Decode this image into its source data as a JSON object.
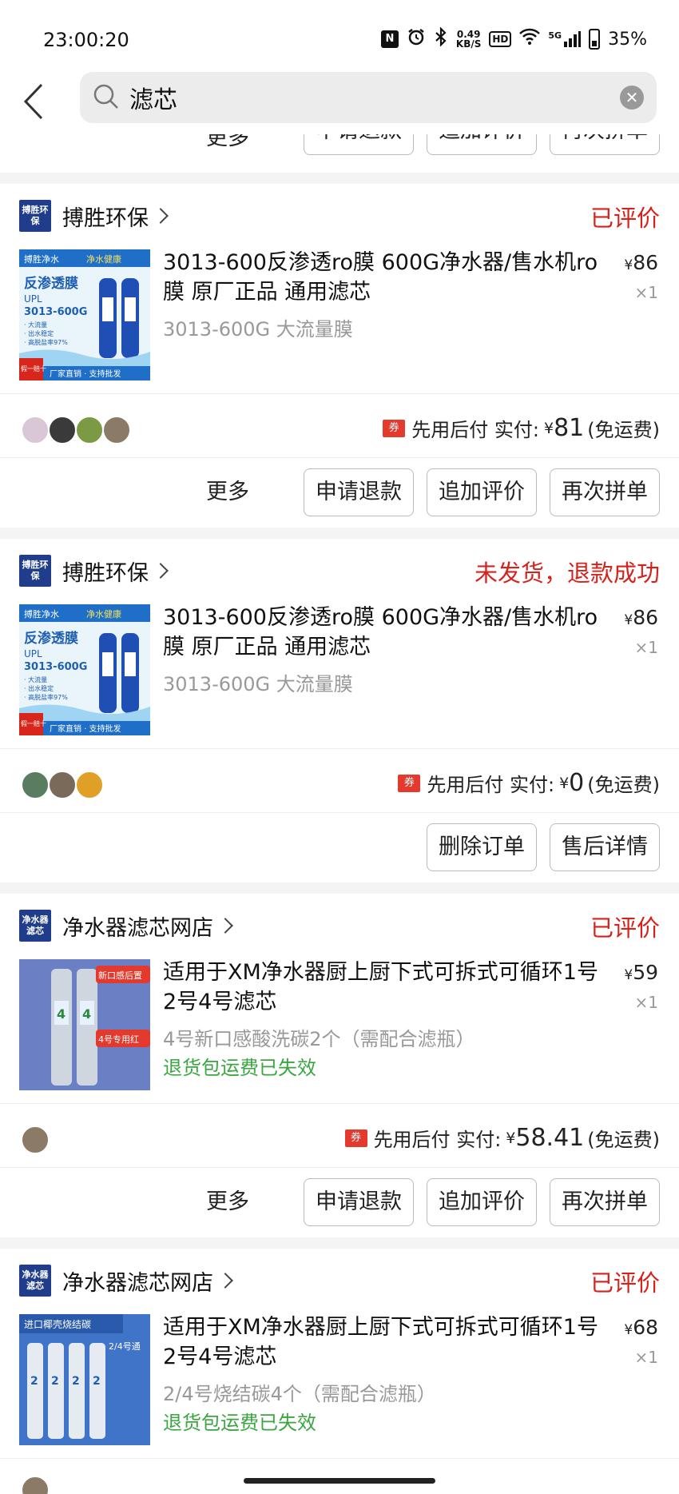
{
  "statusbar": {
    "time": "23:00:20",
    "nfc": "N",
    "speed_top": "0.49",
    "speed_bottom": "KB/S",
    "hd": "HD",
    "net": "5G",
    "battery": "35%"
  },
  "search": {
    "query": "滤芯"
  },
  "top_partial": {
    "more": "更多",
    "buttons": [
      "申请退款",
      "追加评价",
      "再次拼单"
    ]
  },
  "orders": [
    {
      "shop": "搏胜环保",
      "shop_logo": "搏胜环保",
      "status": "已评价",
      "title": "3013-600反渗透ro膜 600G净水器/售水机ro膜 原厂正品 通用滤芯",
      "spec": "3013-600G 大流量膜",
      "note": "",
      "price_symbol": "¥",
      "price": "86",
      "qty": "×1",
      "coupon": "券",
      "pay_label": "先用后付 实付:",
      "pay_symbol": "¥",
      "pay_amount": "81",
      "shipping": "(免运费)",
      "more": "更多",
      "buttons": [
        "申请退款",
        "追加评价",
        "再次拼单"
      ],
      "thumb": {
        "banner_left": "搏胜净水",
        "banner_right": "净水健康",
        "big": "反渗透膜",
        "model1": "UPL",
        "model2": "3013-600G",
        "bullets": [
          "· 大流量",
          "· 出水稳定",
          "· 高脱盐率97%"
        ],
        "badge": "假一赔十",
        "footer": "厂家直销 · 支持批发"
      }
    },
    {
      "shop": "搏胜环保",
      "shop_logo": "搏胜环保",
      "status": "未发货，退款成功",
      "title": "3013-600反渗透ro膜 600G净水器/售水机ro膜 原厂正品 通用滤芯",
      "spec": "3013-600G 大流量膜",
      "note": "",
      "price_symbol": "¥",
      "price": "86",
      "qty": "×1",
      "coupon": "券",
      "pay_label": "先用后付 实付:",
      "pay_symbol": "¥",
      "pay_amount": "0",
      "shipping": "(免运费)",
      "more": "",
      "buttons": [
        "删除订单",
        "售后详情"
      ],
      "thumb": {
        "banner_left": "搏胜净水",
        "banner_right": "净水健康",
        "big": "反渗透膜",
        "model1": "UPL",
        "model2": "3013-600G",
        "bullets": [
          "· 大流量",
          "· 出水稳定",
          "· 高脱盐率97%"
        ],
        "badge": "假一赔十",
        "footer": "厂家直销 · 支持批发"
      }
    },
    {
      "shop": "净水器滤芯网店",
      "shop_logo": "净水器滤芯",
      "status": "已评价",
      "title": "适用于XM净水器厨上厨下式可拆式可循环1号2号4号滤芯",
      "spec": "4号新口感酸洗碳2个（需配合滤瓶）",
      "note": "退货包运费已失效",
      "price_symbol": "¥",
      "price": "59",
      "qty": "×1",
      "coupon": "券",
      "pay_label": "先用后付 实付:",
      "pay_symbol": "¥",
      "pay_amount": "58.41",
      "shipping": "(免运费)",
      "more": "更多",
      "buttons": [
        "申请退款",
        "追加评价",
        "再次拼单"
      ],
      "thumb": {
        "tag1": "新口感后置",
        "tag2": "4号专用红",
        "digit": "4"
      }
    },
    {
      "shop": "净水器滤芯网店",
      "shop_logo": "净水器滤芯",
      "status": "已评价",
      "title": "适用于XM净水器厨上厨下式可拆式可循环1号2号4号滤芯",
      "spec": "2/4号烧结碳4个（需配合滤瓶）",
      "note": "退货包运费已失效",
      "price_symbol": "¥",
      "price": "68",
      "qty": "×1",
      "thumb": {
        "tag1": "进口椰壳烧结碳",
        "tag2": "2/4号通",
        "digit": "2"
      }
    }
  ]
}
